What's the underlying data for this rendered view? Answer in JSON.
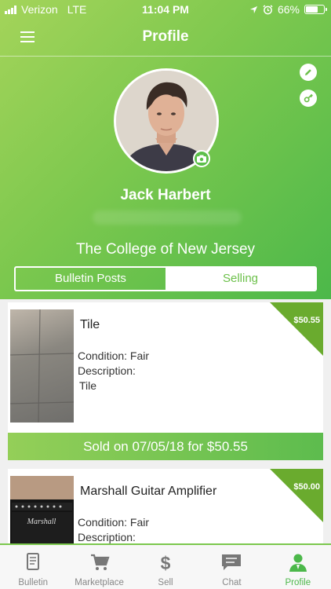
{
  "status_bar": {
    "carrier": "Verizon",
    "network": "LTE",
    "time": "11:04 PM",
    "battery": "66%",
    "battery_level": 0.66
  },
  "header": {
    "title": "Profile"
  },
  "profile": {
    "name": "Jack Harbert",
    "college": "The College of New Jersey"
  },
  "tabs": [
    {
      "label": "Bulletin Posts",
      "selected": false
    },
    {
      "label": "Selling",
      "selected": true
    }
  ],
  "listings": [
    {
      "title": "Tile",
      "condition": "Condition: Fair",
      "description_label": "Description:",
      "description": "Tile",
      "price": "$50.55",
      "sold_text": "Sold on 07/05/18 for $50.55"
    },
    {
      "title": "Marshall Guitar Amplifier",
      "condition": "Condition: Fair",
      "description_label": "Description:",
      "price": "$50.00",
      "brand_text": "Marshall"
    }
  ],
  "tab_bar": [
    {
      "label": "Bulletin",
      "icon": "bulletin-icon"
    },
    {
      "label": "Marketplace",
      "icon": "cart-icon"
    },
    {
      "label": "Sell",
      "icon": "dollar-icon"
    },
    {
      "label": "Chat",
      "icon": "chat-icon"
    },
    {
      "label": "Profile",
      "icon": "profile-icon",
      "active": true
    }
  ],
  "colors": {
    "accent": "#6cc04a",
    "gradient_start": "#a4d45a",
    "gradient_end": "#4cb84a"
  }
}
